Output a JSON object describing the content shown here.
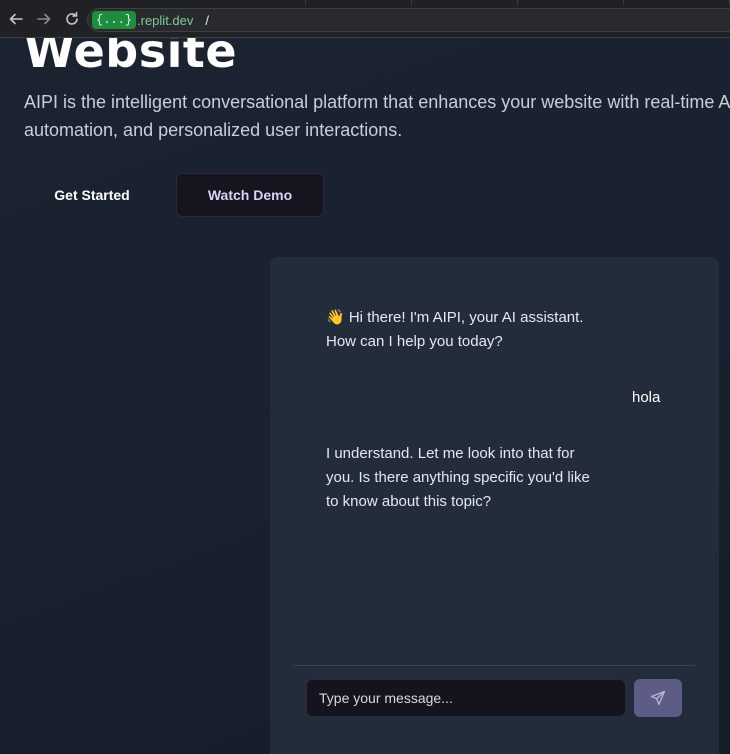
{
  "browser": {
    "back_icon": "arrow-left-icon",
    "forward_icon": "arrow-right-icon",
    "reload_icon": "reload-icon",
    "url_chip": "{...}",
    "url_domain": ".replit.dev",
    "url_path": "/"
  },
  "hero": {
    "title": "Website",
    "description_line1": "AIPI is the intelligent conversational platform that enhances your website with real-time AI",
    "description_line2": "automation, and personalized user interactions.",
    "primary_button": "Get Started",
    "secondary_button": "Watch Demo"
  },
  "chat": {
    "messages": [
      {
        "sender": "bot",
        "text": "👋 Hi there! I'm AIPI, your AI assistant. How can I help you today?"
      },
      {
        "sender": "user",
        "text": "hola"
      },
      {
        "sender": "bot",
        "text": "I understand. Let me look into that for you. Is there anything specific you'd like to know about this topic?"
      }
    ],
    "input_placeholder": "Type your message...",
    "send_icon": "send-icon"
  },
  "colors": {
    "page_bg": "#1a2232",
    "chat_panel_bg": "#232c3b",
    "send_button": "#5d5c86",
    "demo_button_bg": "#16141f",
    "url_chip_bg": "#1e8e3e"
  }
}
